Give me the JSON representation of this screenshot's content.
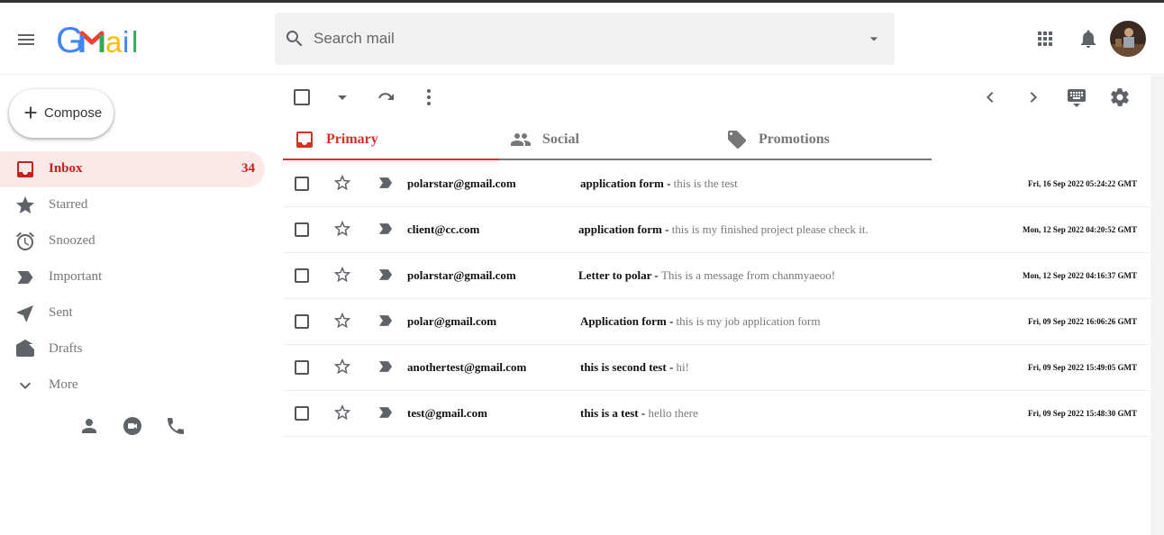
{
  "header": {
    "logo_text": "Gmail",
    "search_placeholder": "Search mail"
  },
  "sidebar": {
    "compose_label": "Compose",
    "items": [
      {
        "label": "Inbox",
        "count": "34",
        "icon": "inbox-icon"
      },
      {
        "label": "Starred",
        "icon": "star-icon"
      },
      {
        "label": "Snoozed",
        "icon": "clock-icon"
      },
      {
        "label": "Important",
        "icon": "label-icon"
      },
      {
        "label": "Sent",
        "icon": "send-icon"
      },
      {
        "label": "Drafts",
        "icon": "draft-icon"
      },
      {
        "label": "More",
        "icon": "chevron-down-icon"
      }
    ]
  },
  "tabs": [
    {
      "label": "Primary",
      "icon": "inbox-icon"
    },
    {
      "label": "Social",
      "icon": "people-icon"
    },
    {
      "label": "Promotions",
      "icon": "tag-icon"
    }
  ],
  "emails": [
    {
      "sender": "polarstar@gmail.com",
      "subject": "application form",
      "snippet": "this is the test",
      "date": "Fri, 16 Sep 2022 05:24:22 GMT"
    },
    {
      "sender": "client@cc.com",
      "subject": "application form",
      "snippet": "this is my finished project please check it.",
      "date": "Mon, 12 Sep 2022 04:20:52 GMT"
    },
    {
      "sender": "polarstar@gmail.com",
      "subject": "Letter to polar",
      "snippet": "This is a message from chanmyaeoo!",
      "date": "Mon, 12 Sep 2022 04:16:37 GMT"
    },
    {
      "sender": "polar@gmail.com",
      "subject": "Application form",
      "snippet": "this is my job application form",
      "date": "Fri, 09 Sep 2022 16:06:26 GMT"
    },
    {
      "sender": "anothertest@gmail.com",
      "subject": "this is second test",
      "snippet": "hi!",
      "date": "Fri, 09 Sep 2022 15:49:05 GMT"
    },
    {
      "sender": "test@gmail.com",
      "subject": "this is a test",
      "snippet": "hello there",
      "date": "Fri, 09 Sep 2022 15:48:30 GMT"
    }
  ],
  "separator": " - ",
  "colors": {
    "accent": "#d93025",
    "active_bg": "#fce8e6",
    "icon_gray": "#5f6368"
  }
}
